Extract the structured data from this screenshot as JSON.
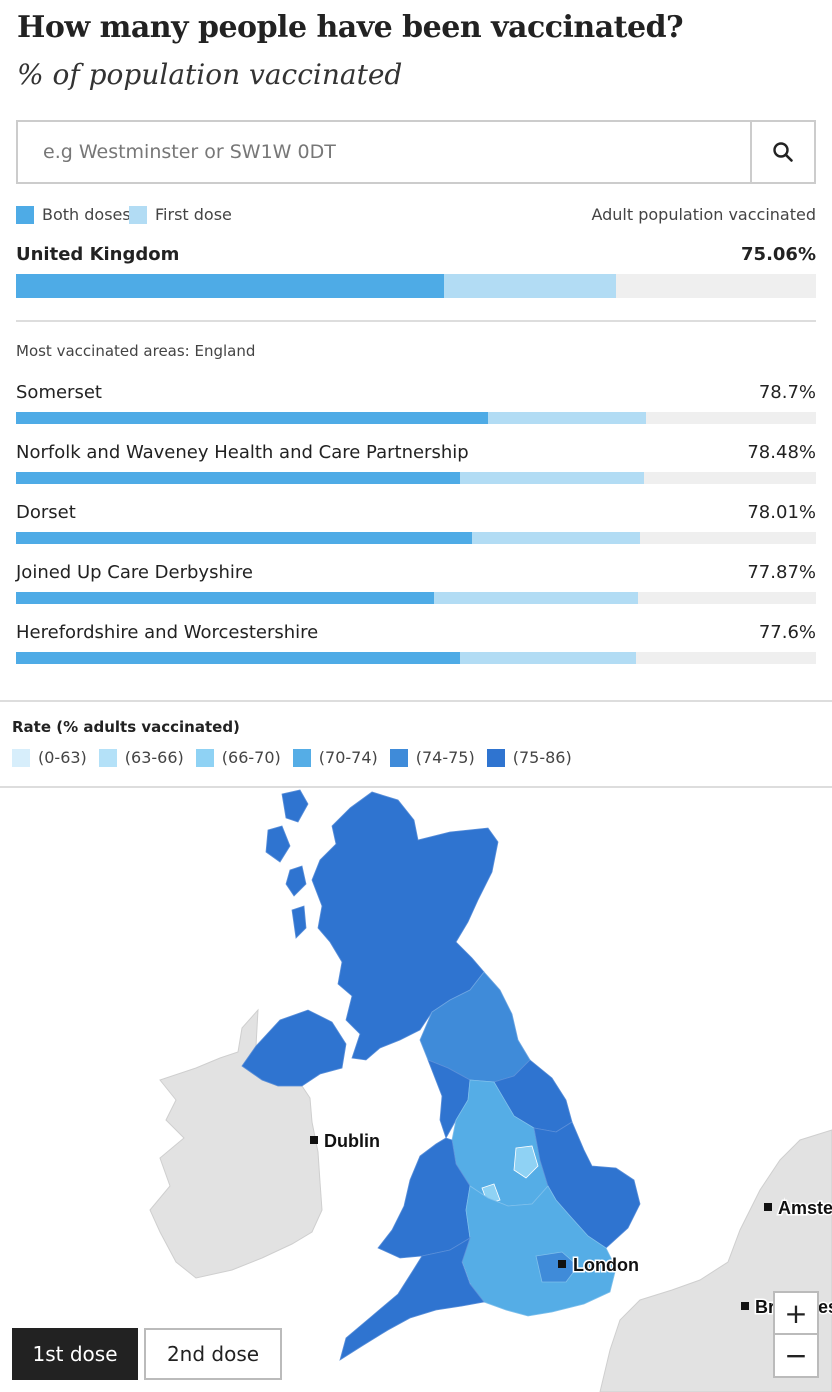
{
  "header": {
    "title": "How many people have been vaccinated?",
    "subtitle": "% of population vaccinated"
  },
  "search": {
    "placeholder": "e.g Westminster or SW1W 0DT"
  },
  "legend": {
    "both": "Both doses",
    "first": "First dose",
    "right_label": "Adult population vaccinated",
    "colors": {
      "both": "#4eabe6",
      "first": "#b2dcf4",
      "track": "#efefef"
    }
  },
  "uk": {
    "name": "United Kingdom",
    "value": "75.06%",
    "both_fraction": 0.535,
    "first_fraction": 0.75
  },
  "most_vaccinated": {
    "heading": "Most vaccinated areas: England",
    "rows": [
      {
        "name": "Somerset",
        "value": "78.7%",
        "both_fraction": 0.59,
        "first_fraction": 0.787
      },
      {
        "name": "Norfolk and Waveney Health and Care Partnership",
        "value": "78.48%",
        "both_fraction": 0.555,
        "first_fraction": 0.785
      },
      {
        "name": "Dorset",
        "value": "78.01%",
        "both_fraction": 0.57,
        "first_fraction": 0.78
      },
      {
        "name": "Joined Up Care Derbyshire",
        "value": "77.87%",
        "both_fraction": 0.522,
        "first_fraction": 0.778
      },
      {
        "name": "Herefordshire and Worcestershire",
        "value": "77.6%",
        "both_fraction": 0.555,
        "first_fraction": 0.775
      }
    ]
  },
  "rate": {
    "title": "Rate (% adults vaccinated)",
    "bins": [
      {
        "label": "(0-63)",
        "color": "#d7eefb"
      },
      {
        "label": "(63-66)",
        "color": "#b4e1f8"
      },
      {
        "label": "(66-70)",
        "color": "#8fd2f4"
      },
      {
        "label": "(70-74)",
        "color": "#55ade6"
      },
      {
        "label": "(74-75)",
        "color": "#3f8bd9"
      },
      {
        "label": "(75-86)",
        "color": "#2f74d0"
      }
    ]
  },
  "map": {
    "cities": {
      "dublin": "Dublin",
      "london": "London",
      "amsterdam": "Amster",
      "brussels": "Br",
      "brussels_tail": "es"
    }
  },
  "controls": {
    "dose1": "1st dose",
    "dose2": "2nd dose",
    "zoom_in": "+",
    "zoom_out": "−"
  }
}
